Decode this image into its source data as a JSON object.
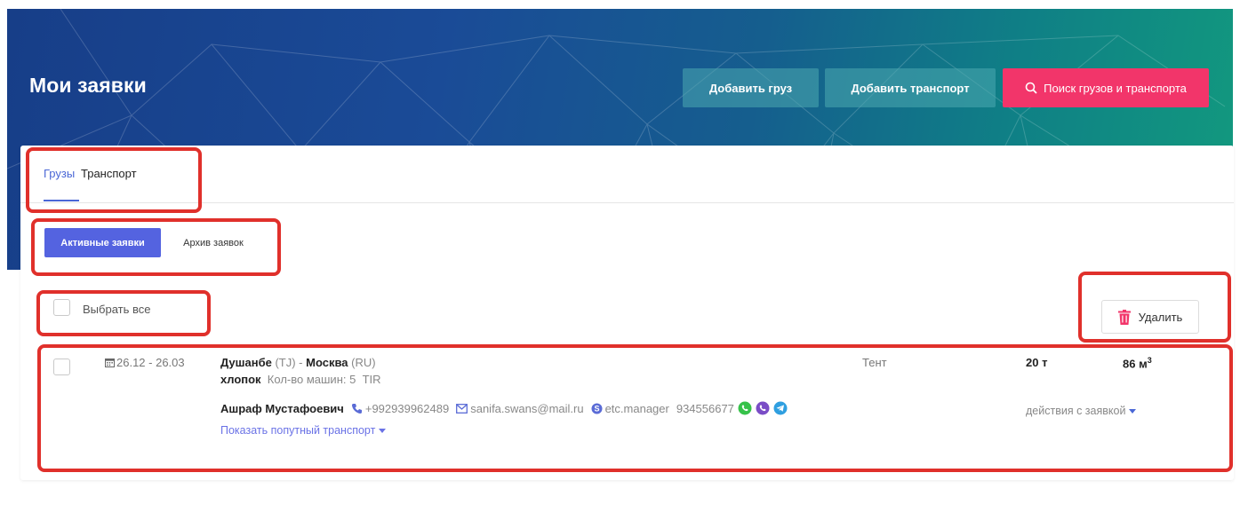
{
  "header": {
    "title": "Мои заявки",
    "add_cargo": "Добавить груз",
    "add_transport": "Добавить транспорт",
    "search": "Поиск грузов и транспорта"
  },
  "tabs": [
    {
      "label": "Грузы",
      "active": true
    },
    {
      "label": "Транспорт",
      "active": false
    }
  ],
  "filters": {
    "active": "Активные заявки",
    "archive": "Архив заявок"
  },
  "select_all": "Выбрать все",
  "delete_label": "Удалить",
  "request": {
    "dates": "26.12 - 26.03",
    "from_city": "Душанбе",
    "from_country": "(TJ)",
    "separator": " - ",
    "to_city": "Москва",
    "to_country": "(RU)",
    "cargo": "хлопок",
    "cars": "Кол-во машин: 5",
    "tir": "TIR",
    "body_type": "Тент",
    "weight": "20 т",
    "volume": "86 м",
    "volume_sup": "3",
    "contact_name": "Ашраф Мустафоевич",
    "phone": "+992939962489",
    "email": "sanifa.swans@mail.ru",
    "skype": "etc.manager",
    "number": "934556677",
    "show_transport": "Показать попутный транспорт",
    "actions": "действия с заявкой"
  },
  "colors": {
    "accent": "#4a67d6",
    "primary_button": "#5463e0",
    "search_button": "#f2356a",
    "delete_icon": "#f2356a",
    "highlight": "#e0302b"
  }
}
